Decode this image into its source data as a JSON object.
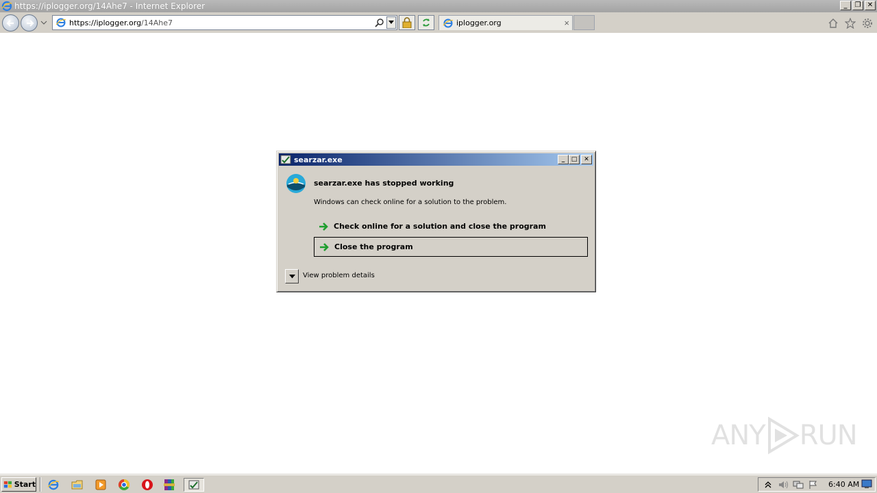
{
  "browser": {
    "window_title": "https://iplogger.org/14Ahe7 - Internet Explorer",
    "address": {
      "prefix": "https://",
      "host": "iplogger.org",
      "path": "/14Ahe7"
    },
    "tab": {
      "label": "iplogger.org",
      "close_glyph": "×"
    },
    "window_controls": {
      "minimize": "_",
      "restore": "❐",
      "close": "✕"
    }
  },
  "dialog": {
    "title": "searzar.exe",
    "heading": "searzar.exe has stopped working",
    "subtext": "Windows can check online for a solution to the problem.",
    "options": [
      {
        "label": "Check online for a solution and close the program"
      },
      {
        "label": "Close the program"
      }
    ],
    "details_label": "View problem details",
    "controls": {
      "minimize": "_",
      "maximize": "□",
      "close": "✕"
    }
  },
  "watermark": {
    "text_left": "ANY",
    "text_right": "RUN"
  },
  "taskbar": {
    "start_label": "Start",
    "quick_launch": [
      "ie-icon",
      "folder-icon",
      "media-player-icon",
      "chrome-icon",
      "opera-icon",
      "winrar-icon",
      "error-app-icon"
    ],
    "clock": "6:40 AM"
  },
  "colors": {
    "dialog_title_start": "#0a246a",
    "dialog_title_end": "#a6caf0",
    "chrome_gray": "#d4d0c8",
    "ie_titlebar": "#a3a3a3"
  }
}
